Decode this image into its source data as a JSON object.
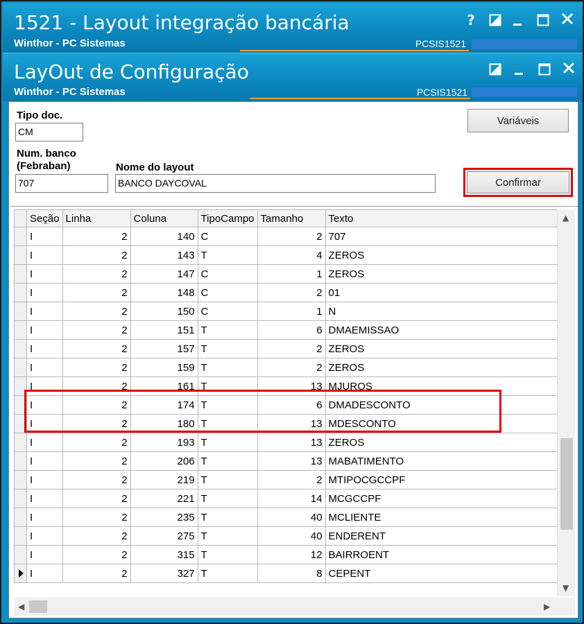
{
  "window_main": {
    "title": "1521 - Layout integração bancária",
    "subtitle": "Winthor - PC Sistemas",
    "code": "PCSIS1521",
    "help_glyph": "?"
  },
  "window_dialog": {
    "title": "LayOut de Configuração",
    "subtitle": "Winthor - PC Sistemas",
    "code": "PCSIS1521"
  },
  "form": {
    "tipo_doc_label": "Tipo doc.",
    "tipo_doc_value": "CM",
    "num_banco_label_1": "Num. banco",
    "num_banco_label_2": "(Febraban)",
    "num_banco_value": "707",
    "nome_layout_label": "Nome do layout",
    "nome_layout_value": "BANCO DAYCOVAL",
    "variaveis_label": "Variáveis",
    "confirmar_label": "Confirmar"
  },
  "grid": {
    "columns": [
      "Seção",
      "Linha",
      "Coluna",
      "TipoCampo",
      "Tamanho",
      "Texto"
    ],
    "rows": [
      [
        "I",
        "2",
        "140",
        "C",
        "2",
        "707"
      ],
      [
        "I",
        "2",
        "143",
        "T",
        "4",
        "ZEROS"
      ],
      [
        "I",
        "2",
        "147",
        "C",
        "1",
        "ZEROS"
      ],
      [
        "I",
        "2",
        "148",
        "C",
        "2",
        "01"
      ],
      [
        "I",
        "2",
        "150",
        "C",
        "1",
        "N"
      ],
      [
        "I",
        "2",
        "151",
        "T",
        "6",
        "DMAEMISSAO"
      ],
      [
        "I",
        "2",
        "157",
        "T",
        "2",
        "ZEROS"
      ],
      [
        "I",
        "2",
        "159",
        "T",
        "2",
        "ZEROS"
      ],
      [
        "I",
        "2",
        "161",
        "T",
        "13",
        "MJUROS"
      ],
      [
        "I",
        "2",
        "174",
        "T",
        "6",
        "DMADESCONTO"
      ],
      [
        "I",
        "2",
        "180",
        "T",
        "13",
        "MDESCONTO"
      ],
      [
        "I",
        "2",
        "193",
        "T",
        "13",
        "ZEROS"
      ],
      [
        "I",
        "2",
        "206",
        "T",
        "13",
        "MABATIMENTO"
      ],
      [
        "I",
        "2",
        "219",
        "T",
        "2",
        "MTIPOCGCCPF"
      ],
      [
        "I",
        "2",
        "221",
        "T",
        "14",
        "MCGCCPF"
      ],
      [
        "I",
        "2",
        "235",
        "T",
        "40",
        "MCLIENTE"
      ],
      [
        "I",
        "2",
        "275",
        "T",
        "40",
        "ENDERENT"
      ],
      [
        "I",
        "2",
        "315",
        "T",
        "12",
        "BAIRROENT"
      ],
      [
        "I",
        "2",
        "327",
        "T",
        "8",
        "CEPENT"
      ]
    ],
    "current_row_index": 18,
    "highlighted_rows": [
      9,
      10
    ]
  },
  "colors": {
    "titlebar": "#0a86bd",
    "highlight": "#e00000",
    "accent_line": "#e8a43c"
  },
  "icons": [
    "help-icon",
    "restore-icon",
    "minimize-icon",
    "maximize-icon",
    "close-icon",
    "row-pointer-icon",
    "scroll-up-icon",
    "scroll-down-icon",
    "scroll-left-icon",
    "scroll-right-icon"
  ]
}
